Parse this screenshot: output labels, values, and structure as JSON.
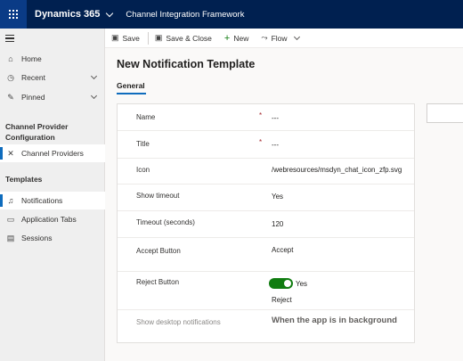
{
  "topbar": {
    "app_name": "Dynamics 365",
    "page_app": "Channel Integration Framework"
  },
  "sidebar": {
    "items_top": [
      {
        "label": "Home",
        "icon": "home-icon"
      },
      {
        "label": "Recent",
        "icon": "clock-icon"
      },
      {
        "label": "Pinned",
        "icon": "pin-icon"
      }
    ],
    "group1_heading": "Channel Provider Configuration",
    "group1_items": [
      {
        "label": "Channel Providers",
        "icon": "network-icon"
      }
    ],
    "group2_heading": "Templates",
    "group2_items": [
      {
        "label": "Notifications",
        "icon": "bell-icon"
      },
      {
        "label": "Application Tabs",
        "icon": "document-icon"
      },
      {
        "label": "Sessions",
        "icon": "sessions-icon"
      }
    ]
  },
  "commands": {
    "save": "Save",
    "save_close": "Save & Close",
    "new": "New",
    "flow": "Flow"
  },
  "page": {
    "title": "New Notification Template",
    "tab_general": "General"
  },
  "form": {
    "name_label": "Name",
    "name_value": "---",
    "title_label": "Title",
    "title_value": "---",
    "icon_label": "Icon",
    "icon_value": "/webresources/msdyn_chat_icon_zfp.svg",
    "show_timeout_label": "Show timeout",
    "show_timeout_value": "Yes",
    "timeout_label": "Timeout (seconds)",
    "timeout_value": "120",
    "accept_label": "Accept Button",
    "accept_value": "Accept",
    "reject_label": "Reject Button",
    "reject_toggle_text": "Yes",
    "reject_value": "Reject",
    "desktop_label": "Show desktop notifications",
    "desktop_value": "When the app is in background",
    "required_marker": "*"
  },
  "colors": {
    "topbar": "#002050",
    "accent": "#0f6cbd",
    "toggle_on": "#107c10"
  }
}
